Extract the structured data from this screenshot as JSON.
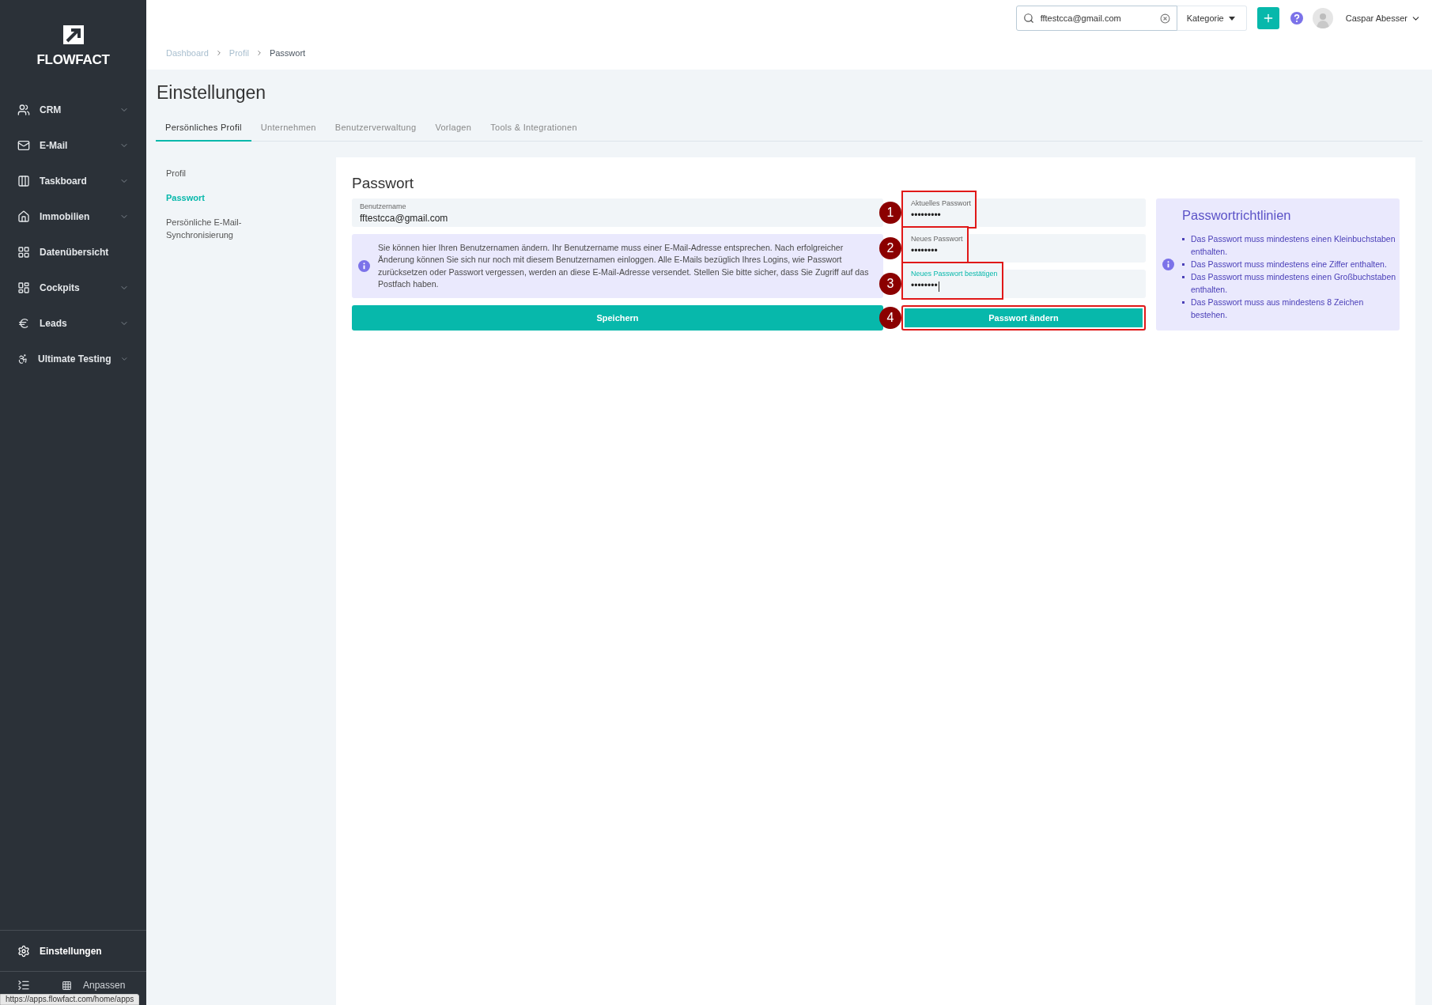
{
  "sidebar": {
    "logo": "FLOWFACT",
    "items": [
      {
        "label": "CRM",
        "expandable": true
      },
      {
        "label": "E-Mail",
        "expandable": true
      },
      {
        "label": "Taskboard",
        "expandable": true
      },
      {
        "label": "Immobilien",
        "expandable": true
      },
      {
        "label": "Datenübersicht",
        "expandable": false
      },
      {
        "label": "Cockpits",
        "expandable": true
      },
      {
        "label": "Leads",
        "expandable": true
      },
      {
        "label": "Ultimate Testing",
        "expandable": true
      }
    ],
    "settings": {
      "label": "Einstellungen"
    },
    "customize": {
      "label": "Anpassen"
    }
  },
  "topbar": {
    "search": {
      "value": "fftestcca@gmail.com"
    },
    "category": "Kategorie",
    "user": "Caspar Abesser"
  },
  "breadcrumb": [
    {
      "label": "Dashboard",
      "current": false
    },
    {
      "label": "Profil",
      "current": false
    },
    {
      "label": "Passwort",
      "current": true
    }
  ],
  "page_title": "Einstellungen",
  "tabs": [
    {
      "label": "Persönliches Profil",
      "selected": true
    },
    {
      "label": "Unternehmen",
      "selected": false
    },
    {
      "label": "Benutzerverwaltung",
      "selected": false
    },
    {
      "label": "Vorlagen",
      "selected": false
    },
    {
      "label": "Tools & Integrationen",
      "selected": false
    }
  ],
  "subnav": [
    {
      "label": "Profil",
      "selected": false
    },
    {
      "label": "Passwort",
      "selected": true
    },
    {
      "label": "Persönliche E-Mail-Synchronisierung",
      "selected": false
    }
  ],
  "card": {
    "title": "Passwort",
    "username": {
      "label": "Benutzername",
      "value": "fftestcca@gmail.com"
    },
    "info": "Sie können hier Ihren Benutzernamen ändern. Ihr Benutzername muss einer E-Mail-Adresse entsprechen. Nach erfolgreicher Änderung können Sie sich nur noch mit diesem Benutzernamen einloggen. Alle E-Mails bezüglich Ihres Logins, wie Passwort zurücksetzen oder Passwort vergessen, werden an diese E-Mail-Adresse versendet. Stellen Sie bitte sicher, dass Sie Zugriff auf das Postfach haben.",
    "save_button": {
      "label": "Speichern",
      "highlighted": false
    },
    "password_fields": [
      {
        "label": "Aktuelles Passwort",
        "value": "•••••••••",
        "focused": false,
        "highlighted": true,
        "marker": "1"
      },
      {
        "label": "Neues Passwort",
        "value": "••••••••",
        "focused": false,
        "highlighted": true,
        "marker": "2"
      },
      {
        "label": "Neues Passwort bestätigen",
        "value": "••••••••",
        "focused": true,
        "highlighted": true,
        "marker": "3"
      }
    ],
    "change_button": {
      "label": "Passwort ändern",
      "highlighted": true,
      "marker": "4"
    },
    "guidelines": {
      "title": "Passwortrichtlinien",
      "rules": [
        "Das Passwort muss mindestens einen Kleinbuchstaben enthalten.",
        "Das Passwort muss mindestens eine Ziffer enthalten.",
        "Das Passwort muss mindestens einen Großbuchstaben enthalten.",
        "Das Passwort muss aus mindestens 8 Zeichen bestehen."
      ]
    }
  },
  "status_url": "https://apps.flowfact.com/home/apps"
}
